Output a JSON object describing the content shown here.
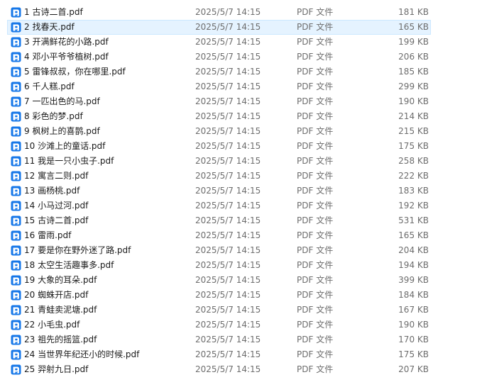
{
  "icon": "pdf-file-icon",
  "colors": {
    "icon_blue": "#1677e8",
    "selection_bg": "#e5f3ff",
    "selection_border": "#cce8ff",
    "secondary_text": "#6d6d6d"
  },
  "files": [
    {
      "name": "1 古诗二首.pdf",
      "date": "2025/5/7 14:15",
      "type": "PDF 文件",
      "size": "181 KB",
      "selected": false
    },
    {
      "name": "2 找春天.pdf",
      "date": "2025/5/7 14:15",
      "type": "PDF 文件",
      "size": "165 KB",
      "selected": true
    },
    {
      "name": "3 开满鲜花的小路.pdf",
      "date": "2025/5/7 14:15",
      "type": "PDF 文件",
      "size": "199 KB",
      "selected": false
    },
    {
      "name": "4 邓小平爷爷植树.pdf",
      "date": "2025/5/7 14:15",
      "type": "PDF 文件",
      "size": "206 KB",
      "selected": false
    },
    {
      "name": "5 雷锋叔叔，你在哪里.pdf",
      "date": "2025/5/7 14:15",
      "type": "PDF 文件",
      "size": "185 KB",
      "selected": false
    },
    {
      "name": "6 千人糕.pdf",
      "date": "2025/5/7 14:15",
      "type": "PDF 文件",
      "size": "299 KB",
      "selected": false
    },
    {
      "name": "7 一匹出色的马.pdf",
      "date": "2025/5/7 14:15",
      "type": "PDF 文件",
      "size": "190 KB",
      "selected": false
    },
    {
      "name": "8 彩色的梦.pdf",
      "date": "2025/5/7 14:15",
      "type": "PDF 文件",
      "size": "214 KB",
      "selected": false
    },
    {
      "name": "9 枫树上的喜鹊.pdf",
      "date": "2025/5/7 14:15",
      "type": "PDF 文件",
      "size": "215 KB",
      "selected": false
    },
    {
      "name": "10 沙滩上的童话.pdf",
      "date": "2025/5/7 14:15",
      "type": "PDF 文件",
      "size": "175 KB",
      "selected": false
    },
    {
      "name": "11 我是一只小虫子.pdf",
      "date": "2025/5/7 14:15",
      "type": "PDF 文件",
      "size": "258 KB",
      "selected": false
    },
    {
      "name": "12 寓言二则.pdf",
      "date": "2025/5/7 14:15",
      "type": "PDF 文件",
      "size": "222 KB",
      "selected": false
    },
    {
      "name": "13 画杨桃.pdf",
      "date": "2025/5/7 14:15",
      "type": "PDF 文件",
      "size": "183 KB",
      "selected": false
    },
    {
      "name": "14 小马过河.pdf",
      "date": "2025/5/7 14:15",
      "type": "PDF 文件",
      "size": "192 KB",
      "selected": false
    },
    {
      "name": "15 古诗二首.pdf",
      "date": "2025/5/7 14:15",
      "type": "PDF 文件",
      "size": "531 KB",
      "selected": false
    },
    {
      "name": "16 雷雨.pdf",
      "date": "2025/5/7 14:15",
      "type": "PDF 文件",
      "size": "165 KB",
      "selected": false
    },
    {
      "name": "17 要是你在野外迷了路.pdf",
      "date": "2025/5/7 14:15",
      "type": "PDF 文件",
      "size": "204 KB",
      "selected": false
    },
    {
      "name": "18 太空生活趣事多.pdf",
      "date": "2025/5/7 14:15",
      "type": "PDF 文件",
      "size": "194 KB",
      "selected": false
    },
    {
      "name": "19 大象的耳朵.pdf",
      "date": "2025/5/7 14:15",
      "type": "PDF 文件",
      "size": "399 KB",
      "selected": false
    },
    {
      "name": "20 蜘蛛开店.pdf",
      "date": "2025/5/7 14:15",
      "type": "PDF 文件",
      "size": "184 KB",
      "selected": false
    },
    {
      "name": "21 青蛙卖泥塘.pdf",
      "date": "2025/5/7 14:15",
      "type": "PDF 文件",
      "size": "167 KB",
      "selected": false
    },
    {
      "name": "22 小毛虫.pdf",
      "date": "2025/5/7 14:15",
      "type": "PDF 文件",
      "size": "190 KB",
      "selected": false
    },
    {
      "name": "23 祖先的摇篮.pdf",
      "date": "2025/5/7 14:15",
      "type": "PDF 文件",
      "size": "170 KB",
      "selected": false
    },
    {
      "name": "24 当世界年纪还小的时候.pdf",
      "date": "2025/5/7 14:15",
      "type": "PDF 文件",
      "size": "175 KB",
      "selected": false
    },
    {
      "name": "25 羿射九日.pdf",
      "date": "2025/5/7 14:15",
      "type": "PDF 文件",
      "size": "207 KB",
      "selected": false
    }
  ]
}
